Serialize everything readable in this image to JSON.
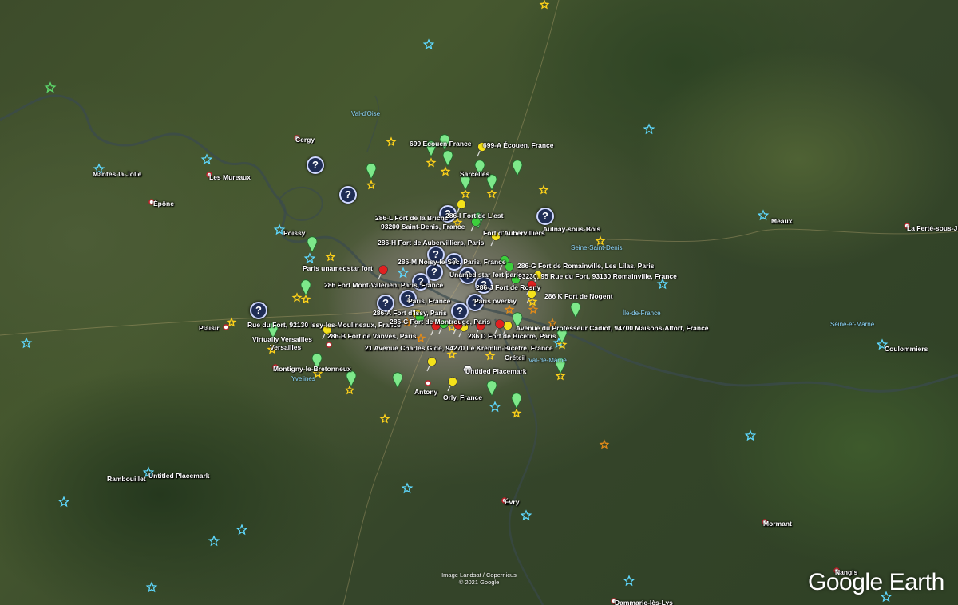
{
  "map": {
    "city_labels": [
      {
        "text": "Cergy"
      },
      {
        "text": "Mantes-la-Jolie"
      },
      {
        "text": "Les Mureaux"
      },
      {
        "text": "Épône"
      },
      {
        "text": "Poissy"
      },
      {
        "text": "Sarcelles"
      },
      {
        "text": "Aulnay-sous-Bois"
      },
      {
        "text": "Meaux"
      },
      {
        "text": "La Ferté-sous-J"
      },
      {
        "text": "Plaisir"
      },
      {
        "text": "Versailles"
      },
      {
        "text": "Montigny-le-Bretonneux"
      },
      {
        "text": "Antony"
      },
      {
        "text": "Créteil"
      },
      {
        "text": "Orly, France"
      },
      {
        "text": "Coulommiers"
      },
      {
        "text": "Rambouillet"
      },
      {
        "text": "Évry"
      },
      {
        "text": "Mormant"
      },
      {
        "text": "Nangis"
      },
      {
        "text": "Dammarie-lès-Lys"
      }
    ],
    "region_labels": [
      {
        "text": "Val-d'Oise"
      },
      {
        "text": "Seine-Saint-Denis"
      },
      {
        "text": "Île-de-France"
      },
      {
        "text": "Seine-et-Marne"
      },
      {
        "text": "Yvelines"
      },
      {
        "text": "Val-de-Marne"
      }
    ],
    "placemark_labels": [
      {
        "text": "699 Ecouen France"
      },
      {
        "text": "699-A Écouen, France"
      },
      {
        "text": "286-L Fort de la Briche"
      },
      {
        "text": "286-I Fort de L'est"
      },
      {
        "text": "93200 Saint-Denis, France"
      },
      {
        "text": "Fort d'Aubervilliers"
      },
      {
        "text": "286-H Fort de Aubervilliers, Paris"
      },
      {
        "text": "Paris unamedstar fort"
      },
      {
        "text": "286-M Noisy-le-Sec, Paris, France"
      },
      {
        "text": "286-G Fort de Romainville, Les Lilas, Paris"
      },
      {
        "text": "Unamed star fort paris"
      },
      {
        "text": "93230, 95 Rue du Fort, 93130 Romainville, France"
      },
      {
        "text": "286 Fort Mont-Valérien, Paris, France"
      },
      {
        "text": "286-J Fort de Rosny"
      },
      {
        "text": "286 K Fort de Nogent"
      },
      {
        "text": "Paris, France"
      },
      {
        "text": "Paris overlay"
      },
      {
        "text": "286-A Fort d'Issy, Paris"
      },
      {
        "text": "Rue du Fort, 92130 Issy-les-Moulineaux, France"
      },
      {
        "text": "286-C Fort de Montrouge, Paris"
      },
      {
        "text": "Avenue du Professeur Cadiot, 94700 Maisons-Alfort, France"
      },
      {
        "text": "Virtually Versailles"
      },
      {
        "text": "286-B Fort de Vanves, Paris"
      },
      {
        "text": "286 D Fort de Bicêtre, Paris"
      },
      {
        "text": "21 Avenue Charles Gide, 94270 Le Kremlin-Bicêtre, France"
      },
      {
        "text": "Untitled Placemark"
      },
      {
        "text": "Untitled Placemark"
      }
    ],
    "credit_line1": "Image Landsat / Copernicus",
    "credit_line2": "© 2021 Google",
    "brand": "Google Earth"
  },
  "colors": {
    "star_cyan": "#5fd9ff",
    "star_yellow": "#ffd21a",
    "star_orange": "#e08a1a",
    "star_green": "#5cd65c",
    "balloon_green": "#7de88a",
    "pushpin_yellow": "#f4e21a",
    "pushpin_red": "#e02020",
    "pushpin_green": "#3ccf3c",
    "question_marker": "#1f2d55",
    "region_label": "#8fd8ff"
  },
  "icons": [
    "star-icon",
    "balloon-icon",
    "pushpin-icon",
    "question-icon",
    "city-dot-icon",
    "hexagon-icon"
  ]
}
